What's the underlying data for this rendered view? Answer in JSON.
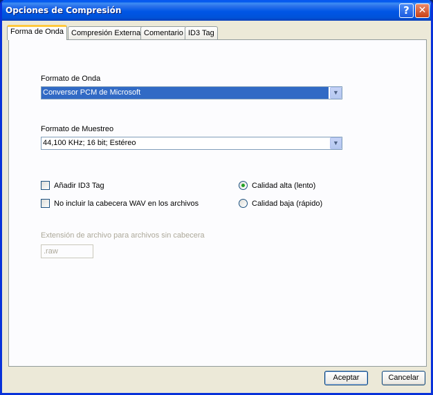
{
  "window": {
    "title": "Opciones de Compresión"
  },
  "tabs": [
    {
      "label": "Forma de Onda",
      "active": true
    },
    {
      "label": "Compresión Externa",
      "active": false
    },
    {
      "label": "Comentario",
      "active": false
    },
    {
      "label": "ID3 Tag",
      "active": false
    }
  ],
  "wave_format": {
    "label": "Formato de Onda",
    "value": "Conversor PCM de Microsoft"
  },
  "sample_format": {
    "label": "Formato de Muestreo",
    "value": "44,100 KHz; 16 bit; Estéreo"
  },
  "checkboxes": [
    {
      "label": "Añadir ID3 Tag",
      "checked": false
    },
    {
      "label": "No incluir la cabecera WAV en los archivos",
      "checked": false
    }
  ],
  "quality": [
    {
      "label": "Calidad alta (lento)",
      "selected": true
    },
    {
      "label": "Calidad baja (rápido)",
      "selected": false
    }
  ],
  "extension": {
    "label": "Extensión de archivo para archivos sin cabecera",
    "value": ".raw"
  },
  "buttons": {
    "ok": "Aceptar",
    "cancel": "Cancelar"
  },
  "colors": {
    "selection": "#316ac5",
    "radio_dot": "#21a121",
    "active_tab_accent": "#ffc83c",
    "titlebar": "#0058ee"
  }
}
